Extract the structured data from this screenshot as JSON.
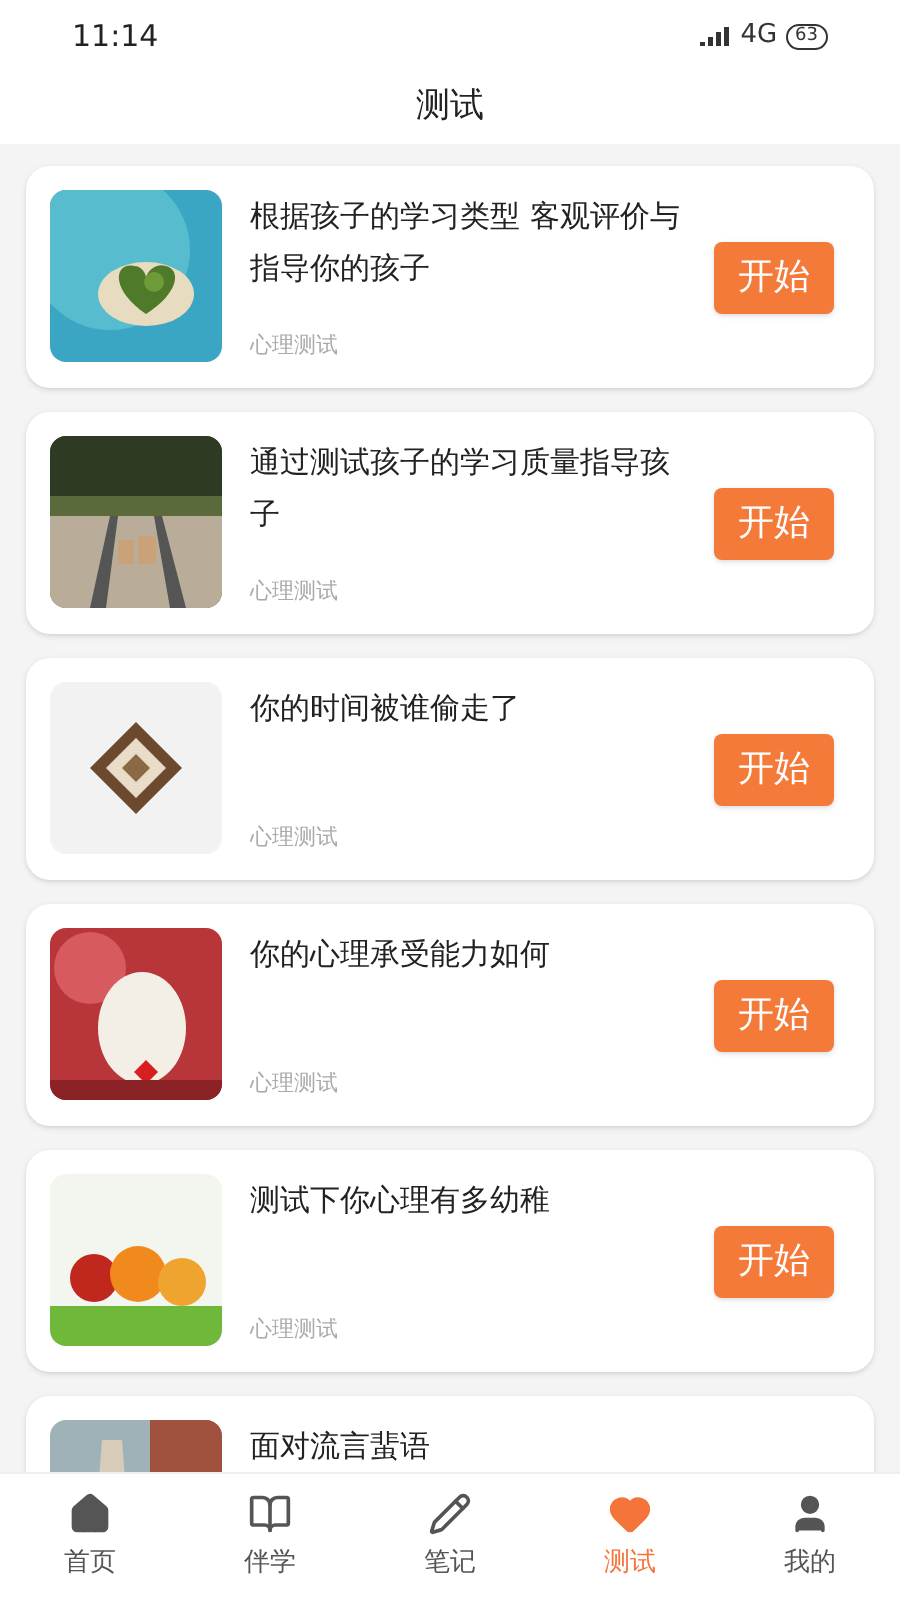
{
  "status_bar": {
    "time": "11:14",
    "network": "4G",
    "battery": "63"
  },
  "title": "测试",
  "tests": [
    {
      "title": "根据孩子的学习类型 客观评价与指导你的孩子",
      "tag": "心理测试",
      "button": "开始"
    },
    {
      "title": "通过测试孩子的学习质量指导孩子",
      "tag": "心理测试",
      "button": "开始"
    },
    {
      "title": "你的时间被谁偷走了",
      "tag": "心理测试",
      "button": "开始"
    },
    {
      "title": "你的心理承受能力如何",
      "tag": "心理测试",
      "button": "开始"
    },
    {
      "title": "测试下你心理有多幼稚",
      "tag": "心理测试",
      "button": "开始"
    },
    {
      "title": "面对流言蜚语"
    }
  ],
  "tabs": [
    {
      "label": "首页",
      "selected": false
    },
    {
      "label": "伴学",
      "selected": false
    },
    {
      "label": "笔记",
      "selected": false
    },
    {
      "label": "测试",
      "selected": true
    },
    {
      "label": "我的",
      "selected": false
    }
  ]
}
